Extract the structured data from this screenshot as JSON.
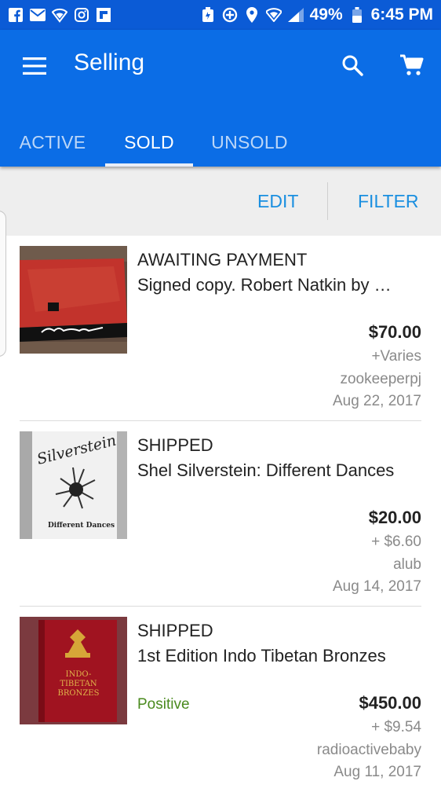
{
  "status_bar": {
    "icons_left": [
      "facebook-icon",
      "mail-icon",
      "wifi-shield-icon",
      "instagram-icon",
      "flipboard-icon"
    ],
    "icons_right": [
      "battery-saver-icon",
      "data-saver-icon",
      "location-icon",
      "wifi-icon",
      "signal-icon"
    ],
    "battery": "49%",
    "time": "6:45 PM"
  },
  "app_bar": {
    "title": "Selling",
    "menu_icon": "hamburger-menu-icon",
    "search_icon": "search-icon",
    "cart_icon": "shopping-cart-icon",
    "background": "#0b6de6"
  },
  "tabs": [
    {
      "label": "ACTIVE",
      "active": false
    },
    {
      "label": "SOLD",
      "active": true
    },
    {
      "label": "UNSOLD",
      "active": false
    }
  ],
  "toolbar": {
    "edit_label": "EDIT",
    "filter_label": "FILTER",
    "accent": "#1a8fe0"
  },
  "items": [
    {
      "status": "AWAITING PAYMENT",
      "name": "Signed copy.  Robert Natkin by …",
      "price": "$70.00",
      "shipping": "+Varies",
      "buyer": "zookeeperpj",
      "date": "Aug 22, 2017",
      "feedback": ""
    },
    {
      "status": "SHIPPED",
      "name": "Shel Silverstein: Different Dances",
      "price": "$20.00",
      "shipping": "+ $6.60",
      "buyer": "alub",
      "date": "Aug 14, 2017",
      "feedback": ""
    },
    {
      "status": "SHIPPED",
      "name": "1st Edition Indo Tibetan Bronzes",
      "price": "$450.00",
      "shipping": "+ $9.54",
      "buyer": "radioactivebaby",
      "date": "Aug 11, 2017",
      "feedback": "Positive"
    }
  ],
  "thumbnails": {
    "item2_lettering": [
      "Silverstein",
      "Different Dances"
    ],
    "item3_lettering": [
      "INDO-",
      "TIBETAN",
      "BRONZES"
    ]
  }
}
